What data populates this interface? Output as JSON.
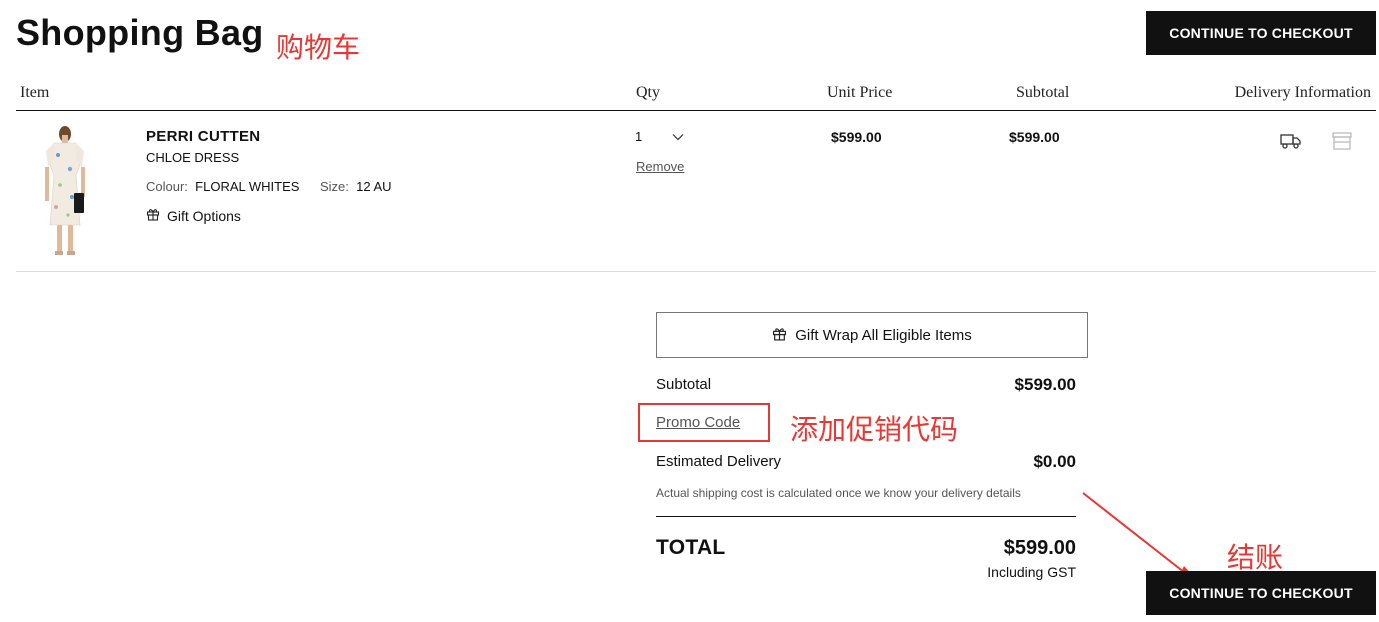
{
  "page": {
    "title": "Shopping Bag",
    "annotations": {
      "cart": "购物车",
      "promo": "添加促销代码",
      "checkout": "结账"
    },
    "checkout_label": "CONTINUE TO CHECKOUT"
  },
  "table": {
    "headers": {
      "item": "Item",
      "qty": "Qty",
      "unit_price": "Unit Price",
      "subtotal": "Subtotal",
      "delivery": "Delivery Information"
    }
  },
  "item": {
    "brand": "PERRI CUTTEN",
    "name": "CHLOE DRESS",
    "colour_label": "Colour:",
    "colour_value": "FLORAL WHITES",
    "size_label": "Size:",
    "size_value": "12 AU",
    "gift_options": "Gift Options",
    "qty": "1",
    "remove": "Remove",
    "unit_price": "$599.00",
    "subtotal": "$599.00"
  },
  "summary": {
    "gift_wrap": "Gift Wrap All Eligible Items",
    "subtotal_label": "Subtotal",
    "subtotal_value": "$599.00",
    "promo_code": "Promo Code",
    "delivery_label": "Estimated Delivery",
    "delivery_value": "$0.00",
    "shipping_note": "Actual shipping cost is calculated once we know your delivery details",
    "total_label": "TOTAL",
    "total_value": "$599.00",
    "gst_note": "Including GST"
  },
  "icons": {
    "delivery": "truck-icon",
    "store": "store-icon",
    "gift": "gift-icon",
    "qty_dropdown": "chevron-down-icon"
  },
  "colors": {
    "accent": "#111111",
    "annotation": "#e53935"
  }
}
